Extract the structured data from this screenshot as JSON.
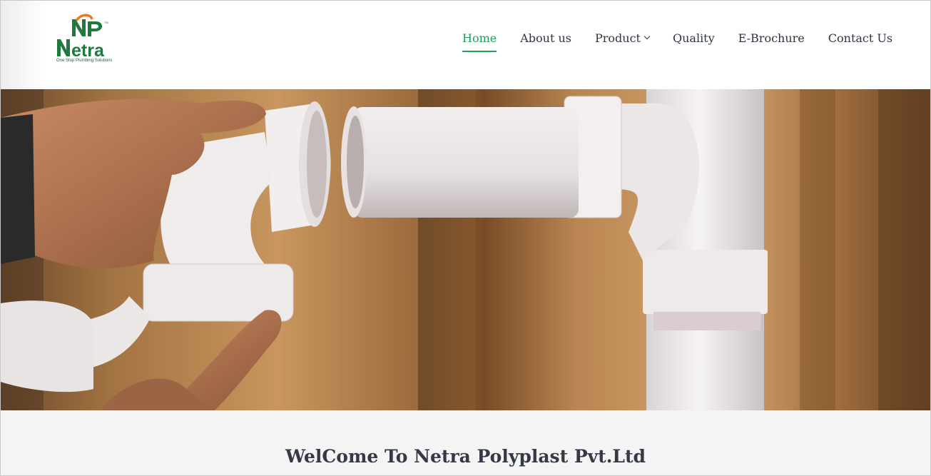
{
  "brand": {
    "logo_text": "Netra",
    "logo_letters": "NP",
    "tagline": "One Stop Plumbing Solutions",
    "colors": {
      "green": "#1aa05a",
      "dark_green": "#1f7a3f",
      "orange": "#e87a23"
    }
  },
  "nav": {
    "items": [
      {
        "label": "Home",
        "active": true
      },
      {
        "label": "About us",
        "active": false
      },
      {
        "label": "Product",
        "active": false,
        "has_dropdown": true
      },
      {
        "label": "Quality",
        "active": false
      },
      {
        "label": "E-Brochure",
        "active": false
      },
      {
        "label": "Contact Us",
        "active": false
      }
    ]
  },
  "hero": {
    "image": "hands-connecting-white-pvc-pipe-fittings"
  },
  "welcome": {
    "title": "WelCome To Netra Polyplast Pvt.Ltd"
  }
}
